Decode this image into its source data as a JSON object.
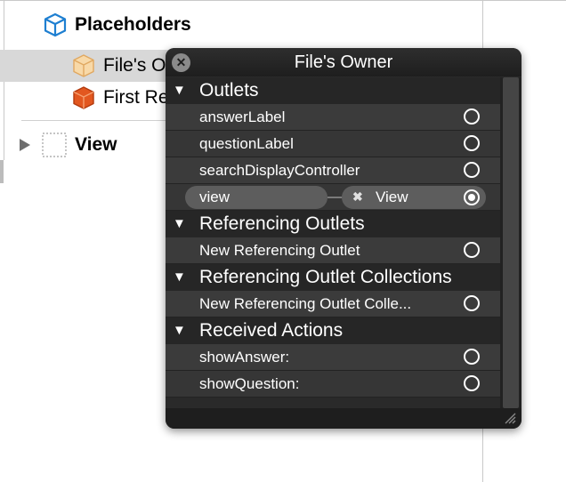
{
  "outline": {
    "placeholders_label": "Placeholders",
    "files_owner_label": "File's Owner",
    "first_responder_label": "First Responder",
    "view_label": "View"
  },
  "hud": {
    "title": "File's Owner",
    "sections": {
      "outlets": "Outlets",
      "referencing_outlets": "Referencing Outlets",
      "referencing_outlet_collections": "Referencing Outlet Collections",
      "received_actions": "Received Actions"
    },
    "outlets": {
      "row1": "answerLabel",
      "row2": "questionLabel",
      "row3": "searchDisplayController",
      "connected_name": "view",
      "connected_dest": "View"
    },
    "referencing_outlets": {
      "new": "New Referencing Outlet"
    },
    "referencing_outlet_collections": {
      "new": "New Referencing Outlet Colle..."
    },
    "received_actions": {
      "row1": "showAnswer:",
      "row2": "showQuestion:"
    }
  },
  "icons": [
    "cube-icon",
    "files-owner-cube-icon",
    "first-responder-cube-icon",
    "view-icon",
    "disclosure-triangle-icon",
    "close-icon",
    "resize-grip-icon",
    "outlet-circle-icon"
  ],
  "colors": {
    "hud_background": "#2a2a2a",
    "row_light": "#3b3b3b",
    "row_dark": "#363636",
    "placeholder_icon": "#1e7fd1",
    "first_responder_icon": "#e2571f"
  }
}
